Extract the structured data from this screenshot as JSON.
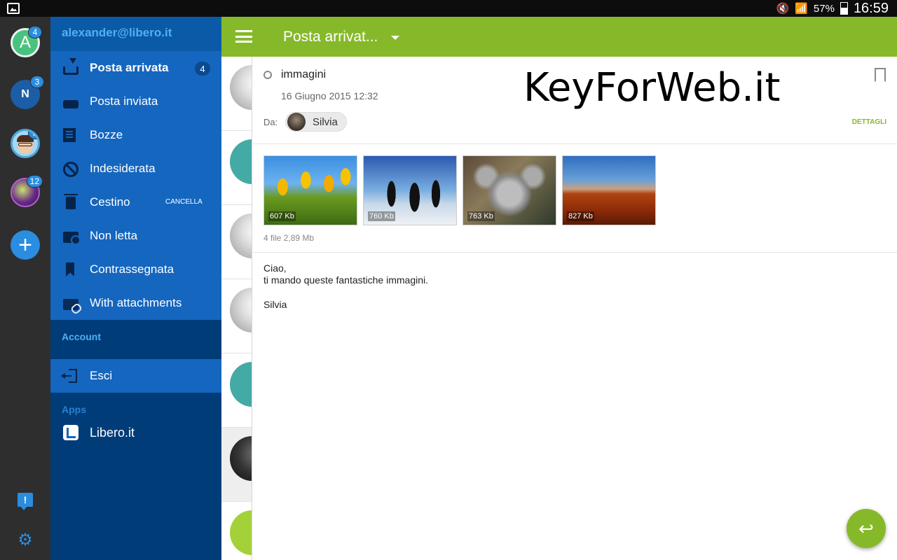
{
  "status_bar": {
    "battery": "57%",
    "time": "16:59"
  },
  "accounts": [
    {
      "initial": "A",
      "badge": "4"
    },
    {
      "initial": "N",
      "badge": "3"
    },
    {
      "initial": "",
      "badge": "8"
    },
    {
      "initial": "",
      "badge": "12"
    }
  ],
  "drawer": {
    "email": "alexander@libero.it",
    "items": [
      {
        "label": "Posta arrivata",
        "count": "4",
        "icon": "inbox-icon"
      },
      {
        "label": "Posta inviata",
        "icon": "sent-icon"
      },
      {
        "label": "Bozze",
        "icon": "drafts-icon"
      },
      {
        "label": "Indesiderata",
        "icon": "spam-icon"
      },
      {
        "label": "Cestino",
        "action": "CANCELLA",
        "icon": "trash-icon"
      },
      {
        "label": "Non letta",
        "icon": "unread-folder-icon"
      },
      {
        "label": "Contrassegnata",
        "icon": "bookmark-icon"
      },
      {
        "label": "With attachments",
        "icon": "attachment-folder-icon"
      }
    ],
    "account_section": "Account",
    "logout": "Esci",
    "apps_section": "Apps",
    "app_libero": "Libero.it"
  },
  "topbar": {
    "folder_title": "Posta arrivat..."
  },
  "message": {
    "subject": "immagini",
    "date": "16 Giugno 2015 12:32",
    "from_label": "Da:",
    "sender": "Silvia",
    "details": "DETTAGLI",
    "watermark": "KeyForWeb.it",
    "attachments": [
      {
        "size": "607 Kb"
      },
      {
        "size": "760 Kb"
      },
      {
        "size": "763 Kb"
      },
      {
        "size": "827 Kb"
      }
    ],
    "attachments_total": "4 file 2,89 Mb",
    "body": {
      "line1": "Ciao,",
      "line2": "ti mando queste fantastiche immagini.",
      "signature": "Silvia"
    }
  },
  "colors": {
    "accent_green": "#86b929",
    "drawer_blue": "#1566bf",
    "drawer_dark": "#003c78",
    "badge_blue": "#2a8de0"
  }
}
